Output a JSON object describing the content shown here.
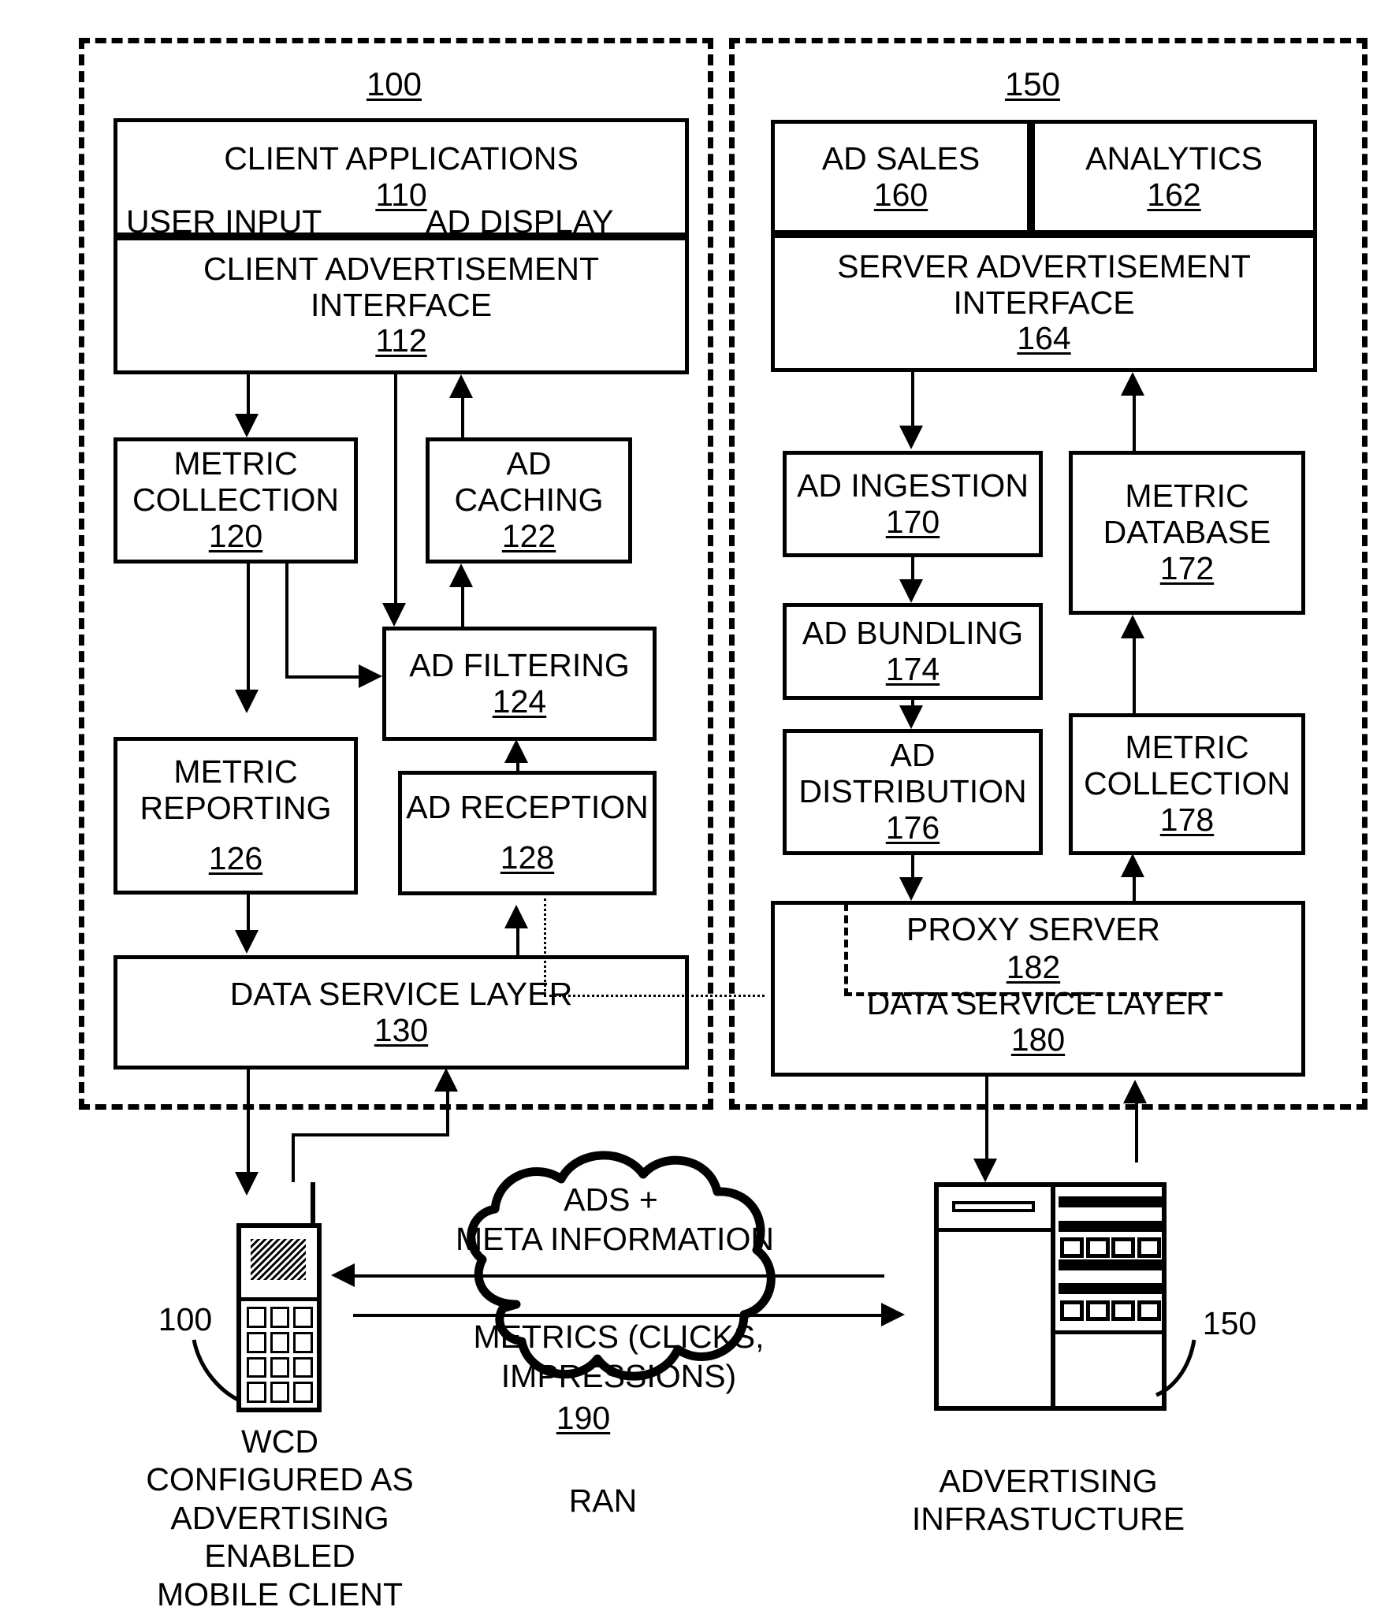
{
  "figure": {
    "client_system_ref": "100",
    "server_system_ref": "150"
  },
  "client_blocks": {
    "client_applications": {
      "title": "CLIENT APPLICATIONS",
      "ref": "110",
      "left_label": "USER INPUT",
      "right_label": "AD DISPLAY"
    },
    "client_ad_interface": {
      "line1": "CLIENT ADVERTISEMENT",
      "line2": "INTERFACE",
      "ref": "112"
    },
    "metric_collection": {
      "line1": "METRIC",
      "line2": "COLLECTION",
      "ref": "120"
    },
    "ad_caching": {
      "line1": "AD",
      "line2": "CACHING",
      "ref": "122"
    },
    "ad_filtering": {
      "line1": "AD FILTERING",
      "ref": "124"
    },
    "metric_reporting": {
      "line1": "METRIC",
      "line2": "REPORTING",
      "ref": "126"
    },
    "ad_reception": {
      "line1": "AD RECEPTION",
      "ref": "128"
    },
    "data_service_layer": {
      "line1": "DATA SERVICE LAYER",
      "ref": "130"
    }
  },
  "server_blocks": {
    "ad_sales": {
      "line1": "AD SALES",
      "ref": "160"
    },
    "analytics": {
      "line1": "ANALYTICS",
      "ref": "162"
    },
    "server_ad_interface": {
      "line1": "SERVER ADVERTISEMENT",
      "line2": "INTERFACE",
      "ref": "164"
    },
    "ad_ingestion": {
      "line1": "AD INGESTION",
      "ref": "170"
    },
    "metric_database": {
      "line1": "METRIC",
      "line2": "DATABASE",
      "ref": "172"
    },
    "ad_bundling": {
      "line1": "AD BUNDLING",
      "ref": "174"
    },
    "ad_distribution": {
      "line1": "AD",
      "line2": "DISTRIBUTION",
      "ref": "176"
    },
    "metric_collection": {
      "line1": "METRIC",
      "line2": "COLLECTION",
      "ref": "178"
    },
    "proxy_server": {
      "line1": "PROXY SERVER",
      "ref": "182"
    },
    "data_service_layer": {
      "line1": "DATA SERVICE LAYER",
      "ref": "180"
    }
  },
  "network": {
    "cloud_line1": "ADS +",
    "cloud_line2": "META INFORMATION",
    "cloud_line3": "METRICS (CLICKS,",
    "cloud_line4": "IMPRESSIONS)",
    "cloud_ref": "190",
    "cloud_name": "RAN"
  },
  "device": {
    "callout_ref": "100",
    "caption": "WCD\nCONFIGURED AS\nADVERTISING\nENABLED\nMOBILE CLIENT"
  },
  "server_icon": {
    "callout_ref": "150",
    "caption": "ADVERTISING\nINFRASTUCTURE"
  }
}
